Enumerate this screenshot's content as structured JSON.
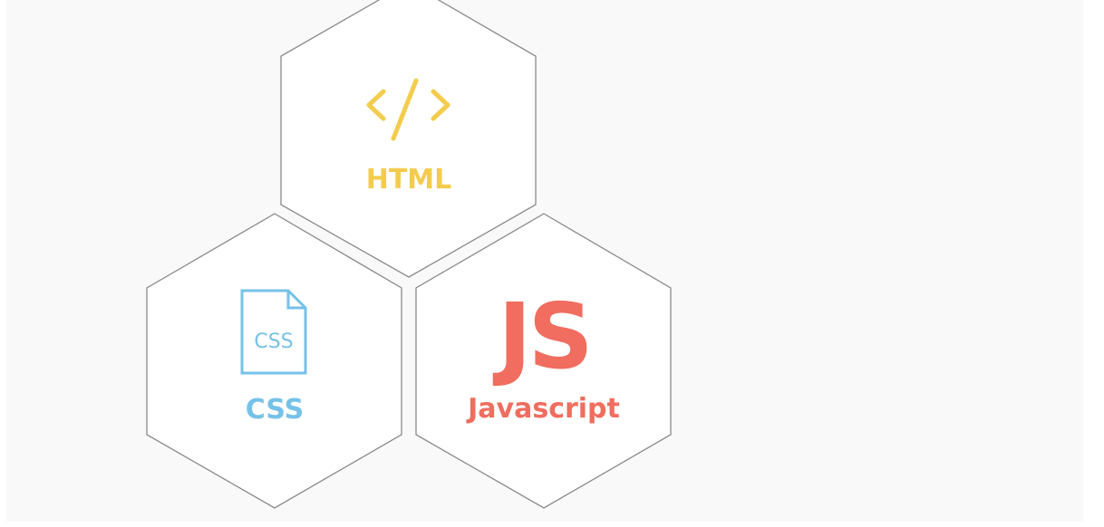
{
  "tiles": {
    "html": {
      "label": "HTML",
      "color": "#f4cc4d",
      "icon": "code-brackets-icon"
    },
    "css": {
      "label": "CSS",
      "icon_text": "CSS",
      "color": "#75c2e8",
      "icon": "css-file-icon"
    },
    "js": {
      "label": "Javascript",
      "icon_text": "JS",
      "color": "#f06d5f",
      "icon": "js-logo-icon"
    }
  }
}
